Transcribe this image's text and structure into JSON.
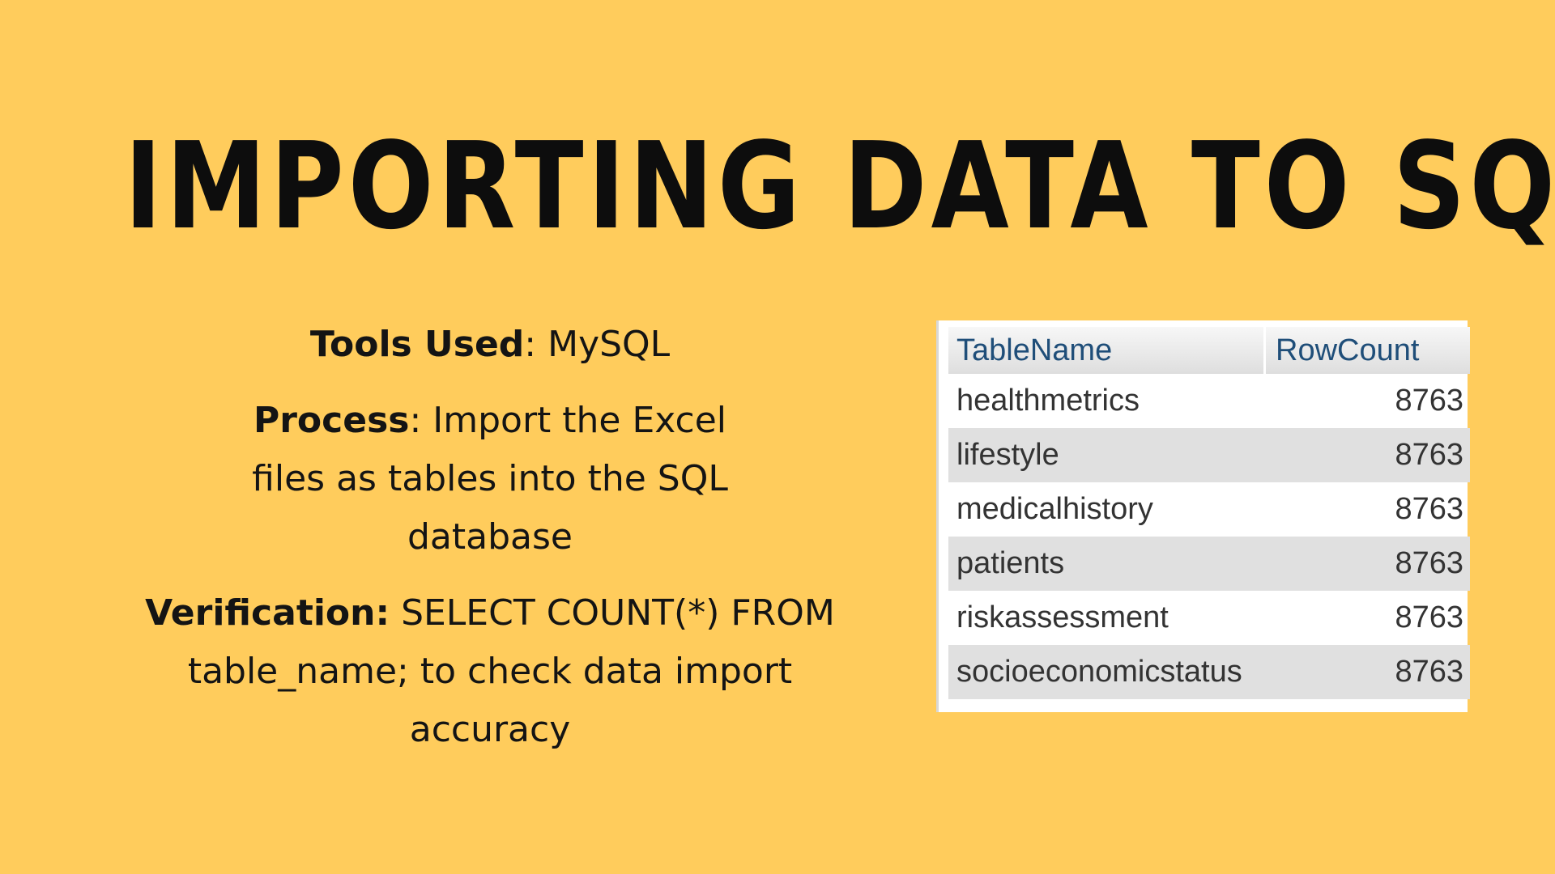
{
  "title": "IMPORTING DATA TO SQL",
  "tools": {
    "label": "Tools Used",
    "value": ": MySQL"
  },
  "process": {
    "label": "Process",
    "value": ": Import the Excel files as tables into the SQL database"
  },
  "verification": {
    "label": "Verification:",
    "value": " SELECT COUNT(*) FROM table_name; to check data import accuracy"
  },
  "table": {
    "headers": [
      "TableName",
      "RowCount"
    ],
    "rows": [
      {
        "name": "healthmetrics",
        "count": "8763"
      },
      {
        "name": "lifestyle",
        "count": "8763"
      },
      {
        "name": "medicalhistory",
        "count": "8763"
      },
      {
        "name": "patients",
        "count": "8763"
      },
      {
        "name": "riskassessment",
        "count": "8763"
      },
      {
        "name": "socioeconomicstatus",
        "count": "8763"
      }
    ]
  },
  "colors": {
    "background": "#FFCC5C",
    "header_text": "#1f4e79"
  }
}
